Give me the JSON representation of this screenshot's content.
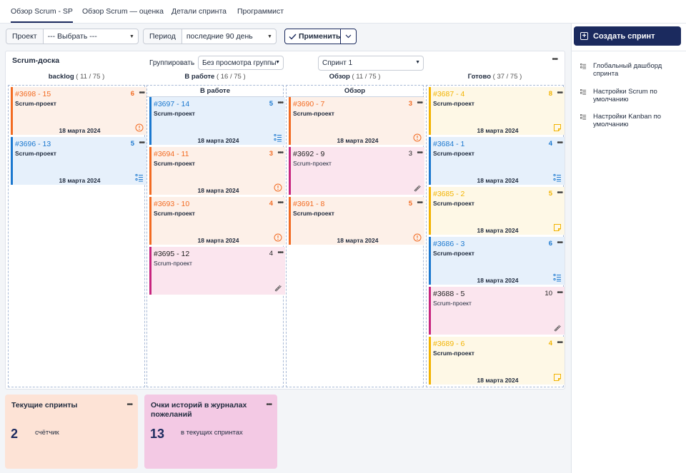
{
  "tabs": [
    {
      "label": "Обзор Scrum - SP"
    },
    {
      "label": "Обзор Scrum — оценка"
    },
    {
      "label": "Детали спринта"
    },
    {
      "label": "Программист"
    }
  ],
  "filters": {
    "project_label": "Проект",
    "project_value": "--- Выбрать ---",
    "period_label": "Период",
    "period_value": "последние 90 день",
    "apply_label": "Применить"
  },
  "board": {
    "title": "Scrum-доска",
    "group_label": "Группировать",
    "group_value": "Без просмотра группы",
    "sprint_value": "Спринт 1",
    "columns": [
      {
        "name": "backlog",
        "count": "( 11 / 75 )",
        "lane": ""
      },
      {
        "name": "В работе",
        "count": "( 16 / 75 )",
        "lane": "В работе"
      },
      {
        "name": "Обзор",
        "count": "( 11 / 75 )",
        "lane": "Обзор"
      },
      {
        "name": "Готово",
        "count": "( 37 / 75 )",
        "lane": ""
      }
    ],
    "cards": [
      [
        {
          "id": "#3698 - 15",
          "project": "Scrum-проект",
          "points": "6",
          "date": "18 марта 2024",
          "color": "orange",
          "icon": "alert"
        },
        {
          "id": "#3696 - 13",
          "project": "Scrum-проект",
          "points": "5",
          "date": "18 марта 2024",
          "color": "blue",
          "icon": "list"
        }
      ],
      [
        {
          "id": "#3697 - 14",
          "project": "Scrum-проект",
          "points": "5",
          "date": "18 марта 2024",
          "color": "blue",
          "icon": "list"
        },
        {
          "id": "#3694 - 11",
          "project": "Scrum-проект",
          "points": "3",
          "date": "18 марта 2024",
          "color": "orange",
          "icon": "alert"
        },
        {
          "id": "#3693 - 10",
          "project": "Scrum-проект",
          "points": "4",
          "date": "18 марта 2024",
          "color": "orange",
          "icon": "alert"
        },
        {
          "id": "#3695 - 12",
          "project": "Scrum-проект",
          "points": "4",
          "date": "",
          "color": "pink",
          "icon": "pen"
        }
      ],
      [
        {
          "id": "#3690 - 7",
          "project": "Scrum-проект",
          "points": "3",
          "date": "18 марта 2024",
          "color": "orange",
          "icon": "alert"
        },
        {
          "id": "#3692 - 9",
          "project": "Scrum-проект",
          "points": "3",
          "date": "",
          "color": "pink",
          "icon": "pen"
        },
        {
          "id": "#3691 - 8",
          "project": "Scrum-проект",
          "points": "5",
          "date": "18 марта 2024",
          "color": "orange",
          "icon": "alert"
        }
      ],
      [
        {
          "id": "#3687 - 4",
          "project": "Scrum-проект",
          "points": "8",
          "date": "18 марта 2024",
          "color": "yellow",
          "icon": "note"
        },
        {
          "id": "#3684 - 1",
          "project": "Scrum-проект",
          "points": "4",
          "date": "18 марта 2024",
          "color": "blue",
          "icon": "list"
        },
        {
          "id": "#3685 - 2",
          "project": "Scrum-проект",
          "points": "5",
          "date": "18 марта 2024",
          "color": "yellow",
          "icon": "note"
        },
        {
          "id": "#3686 - 3",
          "project": "Scrum-проект",
          "points": "6",
          "date": "18 марта 2024",
          "color": "blue",
          "icon": "list"
        },
        {
          "id": "#3688 - 5",
          "project": "Scrum-проект",
          "points": "10",
          "date": "",
          "color": "pink",
          "icon": "pen"
        },
        {
          "id": "#3689 - 6",
          "project": "Scrum-проект",
          "points": "4",
          "date": "18 марта 2024",
          "color": "yellow",
          "icon": "note"
        }
      ]
    ]
  },
  "sidebar": {
    "create_label": "Создать спринт",
    "items": [
      {
        "label": "Глобальный дашборд спринта"
      },
      {
        "label": "Настройки Scrum по умолчанию"
      },
      {
        "label": "Настройки Kanban по умолчанию"
      }
    ]
  },
  "widgets": [
    {
      "title": "Текущие спринты",
      "value": "2",
      "caption": "счётчик",
      "color": "#fde3d6"
    },
    {
      "title": "Очки историй в журналах пожеланий",
      "value": "13",
      "caption": "в текущих спринтах",
      "color": "#f3c9e4"
    }
  ]
}
